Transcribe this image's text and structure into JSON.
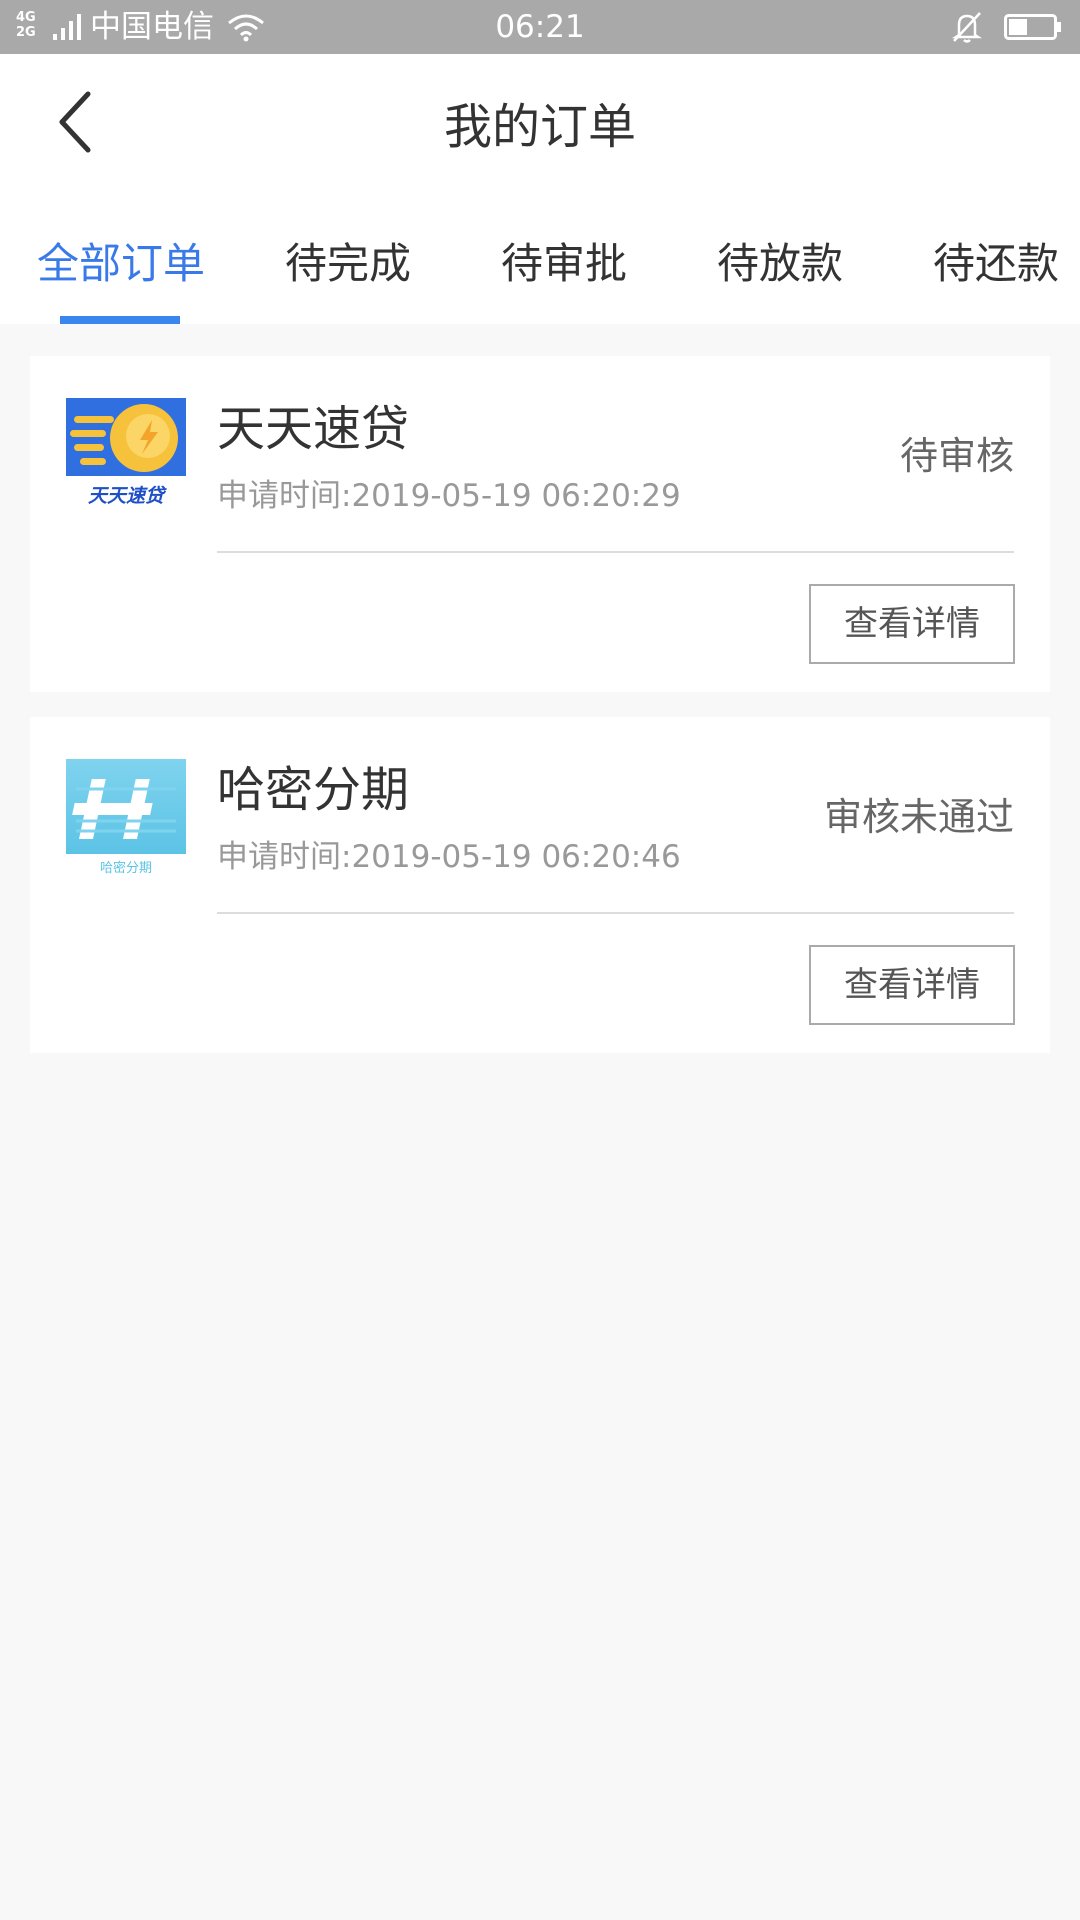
{
  "status_bar": {
    "network_top": "4G",
    "network_bottom": "2G",
    "carrier": "中国电信",
    "time": "06:21",
    "icons": [
      "signal-icon",
      "wifi-icon",
      "bell-muted-icon",
      "battery-icon"
    ]
  },
  "header": {
    "title": "我的订单",
    "back_icon": "chevron-left-icon"
  },
  "tabs": [
    {
      "label": "全部订单",
      "active": true
    },
    {
      "label": "待完成",
      "active": false
    },
    {
      "label": "待审批",
      "active": false
    },
    {
      "label": "待放款",
      "active": false
    },
    {
      "label": "待还款",
      "active": false
    }
  ],
  "orders": [
    {
      "logo_icon": "tiantian-sudai-logo",
      "logo_text": "天天速贷",
      "name": "天天速贷",
      "apply_time": "申请时间:2019-05-19 06:20:29",
      "status": "待审核",
      "button_label": "查看详情"
    },
    {
      "logo_icon": "hami-fenqi-logo",
      "logo_text": "哈密分期",
      "name": "哈密分期",
      "apply_time": "申请时间:2019-05-19 06:20:46",
      "status": "审核未通过",
      "button_label": "查看详情"
    }
  ],
  "colors": {
    "accent": "#3a7ae8",
    "status_bar": "#a9a9a9",
    "page_background": "#f8f8f8",
    "text_primary": "#333333",
    "text_secondary": "#999999"
  }
}
